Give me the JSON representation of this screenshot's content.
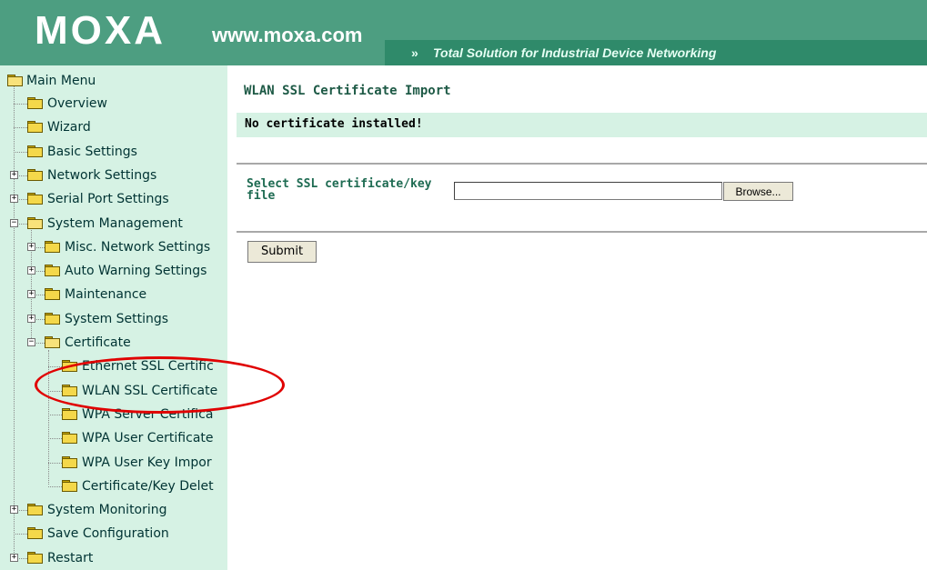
{
  "header": {
    "logo": "MOXA",
    "url": "www.moxa.com",
    "tagline_prefix": "»",
    "tagline": "Total Solution for Industrial Device Networking"
  },
  "sidebar": {
    "root_label": "Main Menu",
    "items": [
      {
        "label": "Overview"
      },
      {
        "label": "Wizard"
      },
      {
        "label": "Basic Settings"
      },
      {
        "label": "Network Settings",
        "expander": "+"
      },
      {
        "label": "Serial Port Settings",
        "expander": "+"
      },
      {
        "label": "System Management",
        "expander": "-"
      },
      {
        "label": "Misc. Network Settings",
        "expander": "+"
      },
      {
        "label": "Auto Warning Settings",
        "expander": "+"
      },
      {
        "label": "Maintenance",
        "expander": "+"
      },
      {
        "label": "System Settings",
        "expander": "+"
      },
      {
        "label": "Certificate",
        "expander": "-"
      },
      {
        "label": "Ethernet SSL Certific"
      },
      {
        "label": "WLAN SSL Certificate"
      },
      {
        "label": "WPA Server Certifica"
      },
      {
        "label": "WPA User Certificate"
      },
      {
        "label": "WPA User Key Impor"
      },
      {
        "label": "Certificate/Key Delet"
      },
      {
        "label": "System Monitoring",
        "expander": "+"
      },
      {
        "label": "Save Configuration"
      },
      {
        "label": "Restart",
        "expander": "+"
      }
    ]
  },
  "main": {
    "title": "WLAN SSL Certificate Import",
    "notice": "No certificate installed!",
    "field_label": "Select SSL certificate/key file",
    "file_value": "",
    "browse_label": "Browse...",
    "submit_label": "Submit"
  },
  "colors": {
    "header_bg": "#4d9e81",
    "sidebar_bg": "#d6f2e4",
    "notice_bg": "#d6f2e4",
    "highlight": "#e00000"
  }
}
